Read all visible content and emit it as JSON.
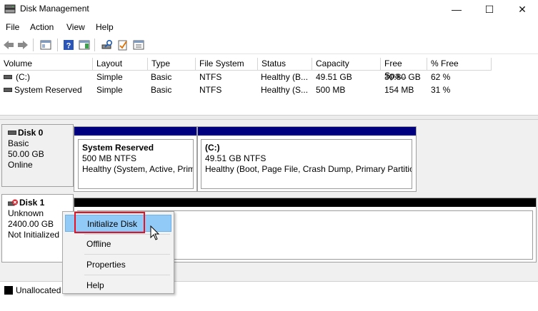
{
  "window": {
    "title": "Disk Management",
    "icon": "disk-management-icon"
  },
  "window_controls": {
    "minimize": "—",
    "maximize": "☐",
    "close": "✕"
  },
  "menu": [
    "File",
    "Action",
    "View",
    "Help"
  ],
  "volume_list": {
    "columns": [
      "Volume",
      "Layout",
      "Type",
      "File System",
      "Status",
      "Capacity",
      "Free Spa...",
      "% Free"
    ],
    "rows": [
      [
        "(C:)",
        "Simple",
        "Basic",
        "NTFS",
        "Healthy (B...",
        "49.51 GB",
        "30.80 GB",
        "62 %"
      ],
      [
        "System Reserved",
        "Simple",
        "Basic",
        "NTFS",
        "Healthy (S...",
        "500 MB",
        "154 MB",
        "31 %"
      ]
    ]
  },
  "disks": [
    {
      "name": "Disk 0",
      "lines": [
        "Basic",
        "50.00 GB",
        "Online"
      ],
      "partitions": [
        {
          "title": "System Reserved",
          "size": "500 MB NTFS",
          "status": "Healthy (System, Active, Prim"
        },
        {
          "title": "(C:)",
          "size": "49.51 GB NTFS",
          "status": "Healthy (Boot, Page File, Crash Dump, Primary Partition"
        }
      ]
    },
    {
      "name": "Disk 1",
      "lines": [
        "Unknown",
        "2400.00 GB",
        "Not Initialized"
      ]
    }
  ],
  "legend": {
    "label": "Unallocated",
    "color": "#000000"
  },
  "context_menu": {
    "items": [
      "Initialize Disk",
      "Offline",
      "Properties",
      "Help"
    ],
    "highlighted": "Initialize Disk"
  },
  "colors": {
    "primary_bar": "#00007f",
    "unallocated_bar": "#000000",
    "highlight": "#91c9f7",
    "callout": "#e81123"
  }
}
